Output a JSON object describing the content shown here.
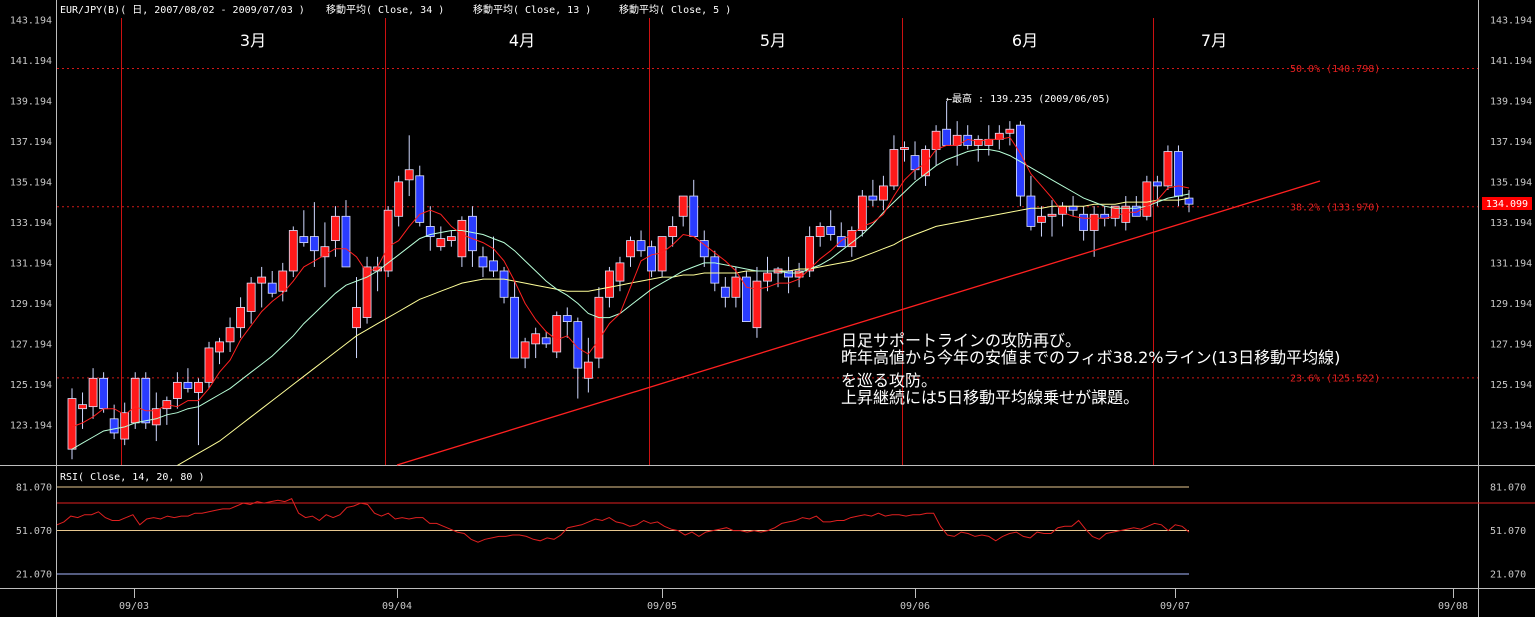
{
  "header": {
    "main_title": "EUR/JPY(B)( 日, 2007/08/02 - 2009/07/03 )",
    "ma_34": "移動平均( Close, 34 )",
    "ma_13": "移動平均( Close, 13 )",
    "ma_5": "移動平均( Close, 5 )"
  },
  "months": [
    "3月",
    "4月",
    "5月",
    "6月",
    "7月"
  ],
  "high_annotation": "←最高 : 139.235 (2009/06/05)",
  "current_price": "134.099",
  "annotation_lines": [
    "日足サポートラインの攻防再び。",
    "昨年高値から今年の安値までのフィボ38.2%ライン(13日移動平均線)",
    "を巡る攻防。",
    "上昇継続には5日移動平均線乗せが課題。"
  ],
  "colors": {
    "background": "#000000",
    "up_candle": "#ff1a1a",
    "down_candle": "#2a3cff",
    "ma_5": "#ff2020",
    "ma_13": "#b8ffd8",
    "ma_34": "#ffff99",
    "support_line": "#ff2020",
    "month_divider": "#cc1111",
    "rsi_line": "#e02020",
    "price_tag": "#ff0000"
  },
  "chart_data": [
    {
      "type": "candlestick",
      "title": "EUR/JPY(B)( 日, 2007/08/02 - 2009/07/03 )",
      "y_ticks": [
        "143.194",
        "141.194",
        "139.194",
        "137.194",
        "135.194",
        "133.194",
        "131.194",
        "129.194",
        "127.194",
        "125.194",
        "123.194"
      ],
      "x_ticks": [
        "09/03",
        "09/04",
        "09/05",
        "09/06",
        "09/07",
        "09/08"
      ],
      "ylim": [
        121.2,
        143.6
      ],
      "legend": [
        "移動平均( Close, 34 )",
        "移動平均( Close, 13 )",
        "移動平均( Close, 5 )"
      ],
      "fib_levels": [
        {
          "label": "50.0% (140.798)",
          "value": 140.798
        },
        {
          "label": "38.2% (133.970)",
          "value": 133.97
        },
        {
          "label": "23.6% (125.522)",
          "value": 125.522
        }
      ],
      "candles": [
        [
          122.0,
          125.0,
          121.5,
          124.5
        ],
        [
          124.0,
          124.8,
          123.0,
          124.2
        ],
        [
          124.1,
          126.0,
          123.5,
          125.5
        ],
        [
          125.5,
          125.8,
          123.8,
          124.0
        ],
        [
          123.5,
          124.2,
          122.5,
          122.8
        ],
        [
          122.5,
          124.3,
          122.2,
          123.8
        ],
        [
          123.3,
          125.8,
          123.0,
          125.5
        ],
        [
          125.5,
          125.8,
          123.0,
          123.3
        ],
        [
          123.2,
          124.8,
          122.4,
          124.0
        ],
        [
          124.0,
          124.6,
          123.2,
          124.4
        ],
        [
          124.5,
          125.8,
          124.0,
          125.3
        ],
        [
          125.3,
          126.0,
          124.8,
          125.0
        ],
        [
          124.8,
          125.5,
          122.2,
          125.3
        ],
        [
          125.3,
          127.3,
          125.0,
          127.0
        ],
        [
          126.8,
          127.5,
          126.2,
          127.3
        ],
        [
          127.3,
          128.5,
          126.8,
          128.0
        ],
        [
          128.0,
          129.5,
          127.5,
          129.0
        ],
        [
          128.8,
          130.5,
          128.2,
          130.2
        ],
        [
          130.2,
          131.0,
          129.0,
          130.5
        ],
        [
          130.2,
          130.8,
          129.5,
          129.7
        ],
        [
          129.8,
          131.2,
          129.3,
          130.8
        ],
        [
          130.8,
          133.0,
          130.5,
          132.8
        ],
        [
          132.5,
          133.8,
          132.0,
          132.2
        ],
        [
          132.5,
          134.2,
          131.0,
          131.8
        ],
        [
          131.5,
          133.2,
          130.0,
          132.0
        ],
        [
          132.3,
          134.0,
          131.5,
          133.5
        ],
        [
          133.5,
          134.3,
          132.8,
          131.0
        ],
        [
          128.0,
          130.5,
          126.5,
          129.0
        ],
        [
          128.5,
          131.5,
          128.2,
          131.0
        ],
        [
          130.8,
          131.5,
          129.8,
          131.0
        ],
        [
          130.8,
          134.0,
          130.5,
          133.8
        ],
        [
          133.5,
          135.5,
          133.0,
          135.2
        ],
        [
          135.3,
          137.5,
          134.5,
          135.8
        ],
        [
          135.5,
          136.0,
          133.0,
          133.2
        ],
        [
          133.0,
          134.0,
          131.8,
          132.5
        ],
        [
          132.0,
          133.0,
          131.8,
          132.4
        ],
        [
          132.3,
          132.8,
          132.0,
          132.5
        ],
        [
          131.5,
          133.5,
          131.0,
          133.3
        ],
        [
          133.5,
          134.0,
          131.0,
          131.8
        ],
        [
          131.5,
          132.0,
          130.5,
          131.0
        ],
        [
          131.3,
          132.5,
          130.5,
          130.8
        ],
        [
          130.8,
          131.0,
          129.2,
          129.5
        ],
        [
          129.5,
          130.3,
          128.0,
          126.5
        ],
        [
          126.5,
          127.5,
          126.0,
          127.3
        ],
        [
          127.2,
          128.0,
          126.5,
          127.7
        ],
        [
          127.5,
          127.8,
          127.0,
          127.2
        ],
        [
          126.8,
          128.8,
          126.5,
          128.6
        ],
        [
          128.6,
          129.0,
          127.5,
          128.3
        ],
        [
          128.3,
          128.5,
          124.5,
          126.0
        ],
        [
          125.5,
          127.5,
          124.8,
          126.3
        ],
        [
          126.5,
          130.0,
          126.0,
          129.5
        ],
        [
          129.5,
          131.0,
          129.0,
          130.8
        ],
        [
          130.3,
          131.5,
          129.8,
          131.2
        ],
        [
          131.5,
          132.5,
          131.0,
          132.3
        ],
        [
          132.3,
          132.8,
          131.5,
          131.8
        ],
        [
          132.0,
          132.3,
          130.5,
          130.8
        ],
        [
          130.8,
          132.5,
          130.5,
          132.5
        ],
        [
          132.5,
          133.5,
          132.0,
          133.0
        ],
        [
          133.5,
          134.5,
          133.0,
          134.5
        ],
        [
          134.5,
          135.3,
          133.0,
          132.5
        ],
        [
          132.3,
          132.8,
          131.0,
          131.5
        ],
        [
          131.5,
          131.8,
          129.8,
          130.2
        ],
        [
          130.0,
          130.5,
          129.0,
          129.5
        ],
        [
          129.5,
          131.0,
          129.0,
          130.5
        ],
        [
          130.5,
          130.8,
          128.5,
          128.3
        ],
        [
          128.0,
          131.0,
          127.5,
          130.3
        ],
        [
          130.3,
          131.5,
          129.8,
          130.7
        ],
        [
          130.7,
          131.0,
          130.0,
          130.9
        ],
        [
          130.8,
          131.5,
          129.7,
          130.5
        ],
        [
          130.5,
          131.2,
          130.0,
          130.8
        ],
        [
          130.8,
          133.0,
          130.5,
          132.5
        ],
        [
          132.5,
          133.2,
          132.0,
          133.0
        ],
        [
          133.0,
          133.8,
          132.3,
          132.6
        ],
        [
          132.5,
          133.2,
          132.0,
          132.0
        ],
        [
          132.0,
          133.0,
          131.5,
          132.8
        ],
        [
          132.8,
          134.8,
          132.5,
          134.5
        ],
        [
          134.5,
          135.3,
          134.0,
          134.3
        ],
        [
          134.3,
          135.5,
          133.8,
          135.0
        ],
        [
          135.0,
          137.5,
          134.8,
          136.8
        ],
        [
          136.8,
          137.2,
          136.2,
          136.9
        ],
        [
          136.5,
          137.2,
          135.3,
          135.8
        ],
        [
          135.5,
          137.0,
          135.0,
          136.8
        ],
        [
          136.8,
          138.0,
          136.0,
          137.7
        ],
        [
          137.8,
          139.2,
          137.0,
          137.0
        ],
        [
          137.0,
          138.2,
          136.0,
          137.5
        ],
        [
          137.5,
          138.0,
          136.8,
          137.0
        ],
        [
          137.0,
          137.5,
          136.2,
          137.3
        ],
        [
          137.0,
          138.0,
          136.5,
          137.3
        ],
        [
          137.3,
          138.0,
          136.8,
          137.6
        ],
        [
          137.6,
          138.2,
          137.0,
          137.8
        ],
        [
          138.0,
          138.2,
          134.0,
          134.5
        ],
        [
          134.5,
          135.5,
          132.8,
          133.0
        ],
        [
          133.2,
          134.0,
          132.5,
          133.5
        ],
        [
          133.5,
          134.3,
          132.5,
          133.6
        ],
        [
          133.6,
          134.2,
          133.0,
          134.0
        ],
        [
          134.0,
          134.5,
          133.5,
          133.8
        ],
        [
          133.6,
          134.0,
          132.3,
          132.8
        ],
        [
          132.8,
          134.0,
          131.5,
          133.6
        ],
        [
          133.6,
          134.0,
          133.0,
          133.4
        ],
        [
          133.4,
          134.0,
          133.0,
          134.0
        ],
        [
          133.2,
          134.5,
          132.8,
          134.0
        ],
        [
          134.0,
          134.5,
          133.5,
          133.5
        ],
        [
          133.5,
          135.5,
          133.3,
          135.2
        ],
        [
          135.2,
          135.5,
          134.0,
          135.0
        ],
        [
          135.0,
          137.0,
          134.8,
          136.7
        ],
        [
          136.7,
          137.0,
          134.0,
          134.5
        ],
        [
          134.4,
          134.8,
          133.7,
          134.1
        ]
      ],
      "ma_5": [
        123.1,
        123.3,
        123.6,
        124.0,
        124.0,
        123.7,
        124.1,
        123.9,
        123.9,
        124.2,
        124.1,
        124.4,
        124.4,
        125.0,
        125.8,
        126.4,
        127.4,
        128.1,
        128.8,
        129.3,
        129.7,
        130.3,
        131.0,
        131.3,
        131.6,
        131.9,
        131.9,
        131.5,
        130.7,
        131.0,
        132.0,
        132.3,
        133.0,
        133.6,
        133.8,
        133.6,
        133.0,
        132.6,
        132.4,
        132.2,
        131.9,
        131.3,
        130.3,
        129.2,
        128.4,
        127.8,
        127.4,
        127.6,
        127.0,
        126.7,
        127.4,
        128.2,
        128.7,
        130.0,
        131.3,
        131.6,
        131.7,
        132.1,
        132.6,
        132.5,
        132.1,
        131.7,
        131.3,
        130.8,
        130.0,
        129.9,
        130.0,
        130.2,
        130.2,
        130.4,
        130.9,
        131.4,
        131.8,
        132.3,
        132.6,
        133.0,
        133.2,
        133.6,
        134.5,
        135.3,
        135.8,
        136.1,
        136.8,
        137.0,
        137.0,
        137.3,
        137.2,
        137.3,
        137.3,
        137.4,
        136.6,
        135.6,
        135.0,
        134.4,
        133.7,
        133.5,
        133.4,
        133.4,
        133.4,
        133.5,
        133.7,
        133.7,
        134.0,
        134.3,
        134.9,
        135.0,
        134.9
      ],
      "ma_13": [
        122.0,
        122.3,
        122.6,
        122.9,
        123.0,
        123.1,
        123.3,
        123.4,
        123.5,
        123.7,
        123.8,
        124.0,
        124.1,
        124.4,
        124.7,
        125.0,
        125.4,
        125.8,
        126.2,
        126.6,
        127.1,
        127.6,
        128.2,
        128.7,
        129.2,
        129.7,
        130.1,
        130.3,
        130.5,
        130.8,
        131.2,
        131.6,
        132.0,
        132.4,
        132.6,
        132.7,
        132.8,
        132.8,
        132.7,
        132.6,
        132.4,
        132.2,
        131.8,
        131.3,
        130.8,
        130.3,
        129.9,
        129.6,
        129.2,
        128.7,
        128.5,
        128.5,
        128.7,
        129.1,
        129.5,
        129.9,
        130.2,
        130.5,
        130.8,
        131.0,
        131.2,
        131.2,
        131.1,
        131.0,
        130.9,
        130.8,
        130.8,
        130.8,
        130.7,
        130.7,
        130.9,
        131.1,
        131.4,
        131.8,
        132.2,
        132.6,
        133.1,
        133.7,
        134.2,
        134.7,
        135.2,
        135.6,
        136.0,
        136.3,
        136.5,
        136.7,
        136.8,
        136.8,
        136.7,
        136.5,
        136.2,
        135.9,
        135.6,
        135.3,
        135.0,
        134.7,
        134.4,
        134.2,
        134.0,
        133.9,
        133.9,
        133.9,
        134.0,
        134.2,
        134.4,
        134.5,
        134.6
      ],
      "ma_34": [
        null,
        null,
        null,
        null,
        null,
        null,
        null,
        null,
        null,
        null,
        121.2,
        121.5,
        121.8,
        122.1,
        122.4,
        122.8,
        123.2,
        123.6,
        124.0,
        124.4,
        124.8,
        125.2,
        125.6,
        126.0,
        126.4,
        126.8,
        127.2,
        127.6,
        127.9,
        128.2,
        128.5,
        128.8,
        129.1,
        129.4,
        129.6,
        129.8,
        130.0,
        130.2,
        130.3,
        130.4,
        130.4,
        130.4,
        130.3,
        130.2,
        130.1,
        130.0,
        129.9,
        129.8,
        129.8,
        129.8,
        129.9,
        130.0,
        130.1,
        130.2,
        130.3,
        130.4,
        130.5,
        130.5,
        130.6,
        130.6,
        130.7,
        130.7,
        130.7,
        130.7,
        130.8,
        130.8,
        130.8,
        130.8,
        130.8,
        130.9,
        130.9,
        131.0,
        131.1,
        131.2,
        131.3,
        131.5,
        131.7,
        131.9,
        132.1,
        132.4,
        132.6,
        132.8,
        133.0,
        133.1,
        133.2,
        133.3,
        133.4,
        133.5,
        133.6,
        133.7,
        133.8,
        133.9,
        133.9,
        134.0,
        134.0,
        134.0,
        134.0,
        134.1,
        134.1,
        134.1,
        134.2,
        134.2,
        134.2,
        134.3,
        134.3,
        134.3,
        134.4
      ]
    },
    {
      "type": "line",
      "title": "RSI( Close, 14, 20, 80 )",
      "y_ticks": [
        "81.070",
        "51.070",
        "21.070"
      ],
      "ylim": [
        10,
        90
      ],
      "reference_levels": [
        81.07,
        70,
        51.07,
        21.07
      ],
      "values": [
        55,
        57,
        61,
        60,
        62,
        62,
        64,
        60,
        58,
        58,
        60,
        62,
        55,
        59,
        60,
        59,
        61,
        60,
        61,
        61,
        63,
        63,
        64,
        65,
        66,
        66,
        68,
        70,
        69,
        71,
        70,
        71,
        72,
        71,
        73,
        63,
        60,
        61,
        58,
        62,
        60,
        62,
        67,
        68,
        70,
        69,
        63,
        61,
        63,
        59,
        60,
        59,
        60,
        60,
        56,
        56,
        54,
        52,
        50,
        49,
        45,
        43,
        45,
        46,
        47,
        47,
        48,
        48,
        47,
        45,
        44,
        46,
        45,
        48,
        53,
        54,
        55,
        57,
        59,
        58,
        60,
        57,
        56,
        54,
        55,
        58,
        56,
        57,
        54,
        52,
        51,
        48,
        50,
        47,
        50,
        51,
        52,
        53,
        51,
        51,
        50,
        51,
        50,
        51,
        53,
        56,
        57,
        58,
        60,
        59,
        61,
        57,
        57,
        58,
        58,
        60,
        61,
        62,
        61,
        63,
        61,
        62,
        62,
        61,
        62,
        62,
        63,
        63,
        54,
        48,
        47,
        50,
        49,
        47,
        48,
        47,
        44,
        47,
        49,
        50,
        47,
        46,
        50,
        49,
        49,
        53,
        54,
        54,
        58,
        52,
        47,
        45,
        49,
        50,
        51,
        52,
        53,
        52,
        54,
        56,
        55,
        51,
        55,
        54,
        50
      ]
    }
  ]
}
